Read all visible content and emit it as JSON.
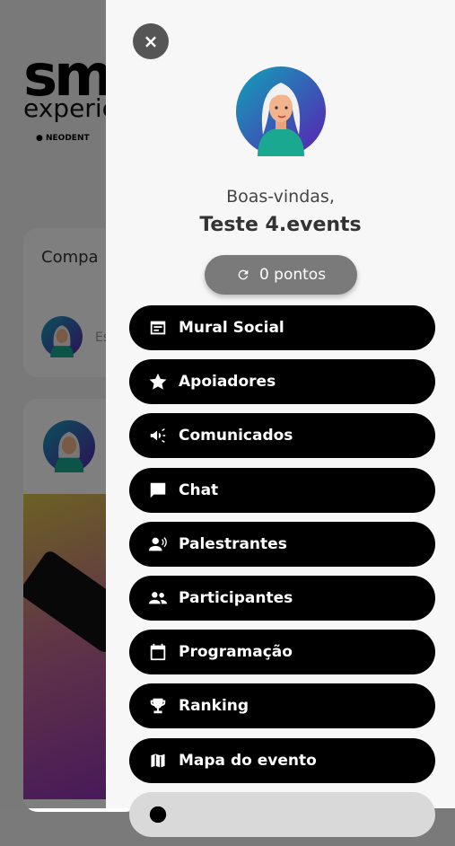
{
  "background": {
    "logo_main": "sm",
    "logo_sub": "experie",
    "logo_brand": "NEODENT",
    "card_label": "Compa",
    "card_hint": "Es"
  },
  "drawer": {
    "close_label": "×",
    "welcome": "Boas-vindas,",
    "username": "Teste 4.events",
    "points_label": "0 pontos",
    "menu": [
      {
        "label": "Mural Social",
        "icon": "feed-icon"
      },
      {
        "label": "Apoiadores",
        "icon": "star-icon"
      },
      {
        "label": "Comunicados",
        "icon": "megaphone-icon"
      },
      {
        "label": "Chat",
        "icon": "chat-icon"
      },
      {
        "label": "Palestrantes",
        "icon": "speaker-icon"
      },
      {
        "label": "Participantes",
        "icon": "people-icon"
      },
      {
        "label": "Programação",
        "icon": "calendar-icon"
      },
      {
        "label": "Ranking",
        "icon": "trophy-icon"
      },
      {
        "label": "Mapa do evento",
        "icon": "map-icon"
      },
      {
        "label": "",
        "icon": "info-icon"
      }
    ]
  }
}
